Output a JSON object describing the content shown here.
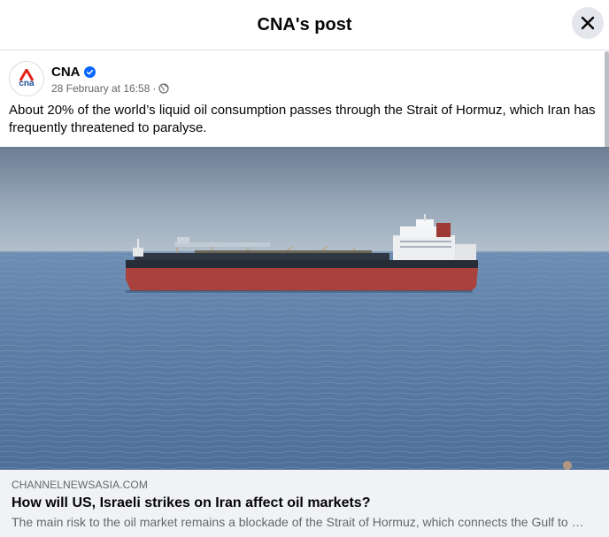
{
  "header": {
    "title": "CNA's post"
  },
  "post": {
    "page_name": "CNA",
    "avatar_text": "cna",
    "timestamp": "28 February at 16:58",
    "separator": "·",
    "caption": "About 20% of the world’s liquid oil consumption passes through the Strait of Hormuz, which Iran has frequently threatened to paralyse."
  },
  "link": {
    "domain": "CHANNELNEWSASIA.COM",
    "title": "How will US, Israeli strikes on Iran affect oil markets?",
    "description": "The main risk to the oil market remains a blockade of the Strait of Hormuz, which connects the Gulf to the Arabian Sea"
  },
  "colors": {
    "brand_red": "#e2231a",
    "verified_blue": "#0866ff",
    "meta_gray": "#65676b"
  },
  "icons": {
    "close": "close-icon",
    "verified": "verified-badge-icon",
    "audience": "globe-icon"
  }
}
